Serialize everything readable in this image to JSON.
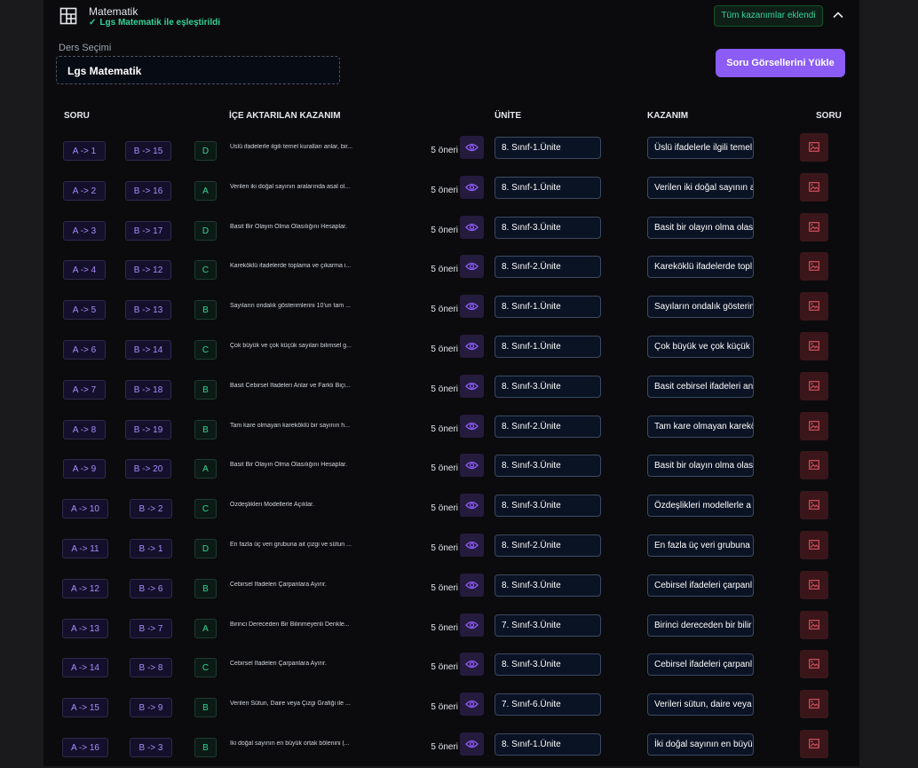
{
  "header": {
    "title": "Matematik",
    "matched_text": "Lgs Matematik ile eşleştirildi",
    "all_added_badge": "Tüm kazanımlar eklendi",
    "accent_color": "#34d399"
  },
  "course": {
    "label": "Ders Seçimi",
    "selected": "Lgs Matematik"
  },
  "upload_button": "Soru Görsellerini Yükle",
  "columns": {
    "soru": "SORU",
    "imported": "İÇE AKTARILAN KAZANIM",
    "unite": "ÜNİTE",
    "kazanim": "KAZANIM",
    "soru_image": "SORU"
  },
  "rows": [
    {
      "a": "A -> 1",
      "b": "B -> 15",
      "ans": "D",
      "text": "Üslü ifadelerle ilgili temel kuralları anlar, bir...",
      "oneri": "5 öneri",
      "unite": "8. Sınıf-1.Ünite",
      "kaz": "Üslü ifadelerle ilgili temel"
    },
    {
      "a": "A -> 2",
      "b": "B -> 16",
      "ans": "A",
      "text": "Verilen iki doğal sayının aralarında asal ol...",
      "oneri": "5 öneri",
      "unite": "8. Sınıf-1.Ünite",
      "kaz": "Verilen iki doğal sayının a"
    },
    {
      "a": "A -> 3",
      "b": "B -> 17",
      "ans": "D",
      "text": "Basit Bir Olayın Olma Olasılığını Hesaplar.",
      "oneri": "5 öneri",
      "unite": "8. Sınıf-3.Ünite",
      "kaz": "Basit bir olayın olma olas"
    },
    {
      "a": "A -> 4",
      "b": "B -> 12",
      "ans": "C",
      "text": "Kareköklü ifadelerde toplama ve çıkarma i...",
      "oneri": "5 öneri",
      "unite": "8. Sınıf-2.Ünite",
      "kaz": "Kareköklü ifadelerde topl"
    },
    {
      "a": "A -> 5",
      "b": "B -> 13",
      "ans": "B",
      "text": "Sayıların ondalık gösterimlerini 10'un tam ...",
      "oneri": "5 öneri",
      "unite": "8. Sınıf-1.Ünite",
      "kaz": "Sayıların ondalık gösterim"
    },
    {
      "a": "A -> 6",
      "b": "B -> 14",
      "ans": "C",
      "text": "Çok büyük ve çok küçük sayıları bilimsel g...",
      "oneri": "5 öneri",
      "unite": "8. Sınıf-1.Ünite",
      "kaz": "Çok büyük ve çok küçük"
    },
    {
      "a": "A -> 7",
      "b": "B -> 18",
      "ans": "B",
      "text": "Basit Cebirsel İfadeleri Anlar ve Farklı Biçi...",
      "oneri": "5 öneri",
      "unite": "8. Sınıf-3.Ünite",
      "kaz": "Basit cebirsel ifadeleri an"
    },
    {
      "a": "A -> 8",
      "b": "B -> 19",
      "ans": "B",
      "text": "Tam kare olmayan kareköklü bir sayının h...",
      "oneri": "5 öneri",
      "unite": "8. Sınıf-2.Ünite",
      "kaz": "Tam kare olmayan karekö"
    },
    {
      "a": "A -> 9",
      "b": "B -> 20",
      "ans": "A",
      "text": "Basit Bir Olayın Olma Olasılığını Hesaplar.",
      "oneri": "5 öneri",
      "unite": "8. Sınıf-3.Ünite",
      "kaz": "Basit bir olayın olma olas"
    },
    {
      "a": "A -> 10",
      "b": "B -> 2",
      "ans": "C",
      "text": "Özdeşlikleri Modellerle Açıklar.",
      "oneri": "5 öneri",
      "unite": "8. Sınıf-3.Ünite",
      "kaz": "Özdeşlikleri modellerle a"
    },
    {
      "a": "A -> 11",
      "b": "B -> 1",
      "ans": "D",
      "text": "En fazla üç veri grubuna ait çizgi ve sütun ...",
      "oneri": "5 öneri",
      "unite": "8. Sınıf-2.Ünite",
      "kaz": "En fazla üç veri grubuna"
    },
    {
      "a": "A -> 12",
      "b": "B -> 6",
      "ans": "B",
      "text": "Cebirsel İfadeleri Çarpanlara Ayırır.",
      "oneri": "5 öneri",
      "unite": "8. Sınıf-3.Ünite",
      "kaz": "Cebirsel ifadeleri çarpanl"
    },
    {
      "a": "A -> 13",
      "b": "B -> 7",
      "ans": "A",
      "text": "Birinci Dereceden Bir Bilinmeyenli Denkle...",
      "oneri": "5 öneri",
      "unite": "7. Sınıf-3.Ünite",
      "kaz": "Birinci dereceden bir bilir"
    },
    {
      "a": "A -> 14",
      "b": "B -> 8",
      "ans": "C",
      "text": "Cebirsel İfadeleri Çarpanlara Ayırır.",
      "oneri": "5 öneri",
      "unite": "8. Sınıf-3.Ünite",
      "kaz": "Cebirsel ifadeleri çarpanl"
    },
    {
      "a": "A -> 15",
      "b": "B -> 9",
      "ans": "B",
      "text": "Verileri Sütun, Daire veya Çizgi Grafiği ile ...",
      "oneri": "5 öneri",
      "unite": "7. Sınıf-6.Ünite",
      "kaz": "Verileri sütun, daire veya"
    },
    {
      "a": "A -> 16",
      "b": "B -> 3",
      "ans": "B",
      "text": "İki doğal sayının en büyük ortak bölenini (...",
      "oneri": "5 öneri",
      "unite": "8. Sınıf-1.Ünite",
      "kaz": "İki doğal sayının en büyü"
    }
  ]
}
